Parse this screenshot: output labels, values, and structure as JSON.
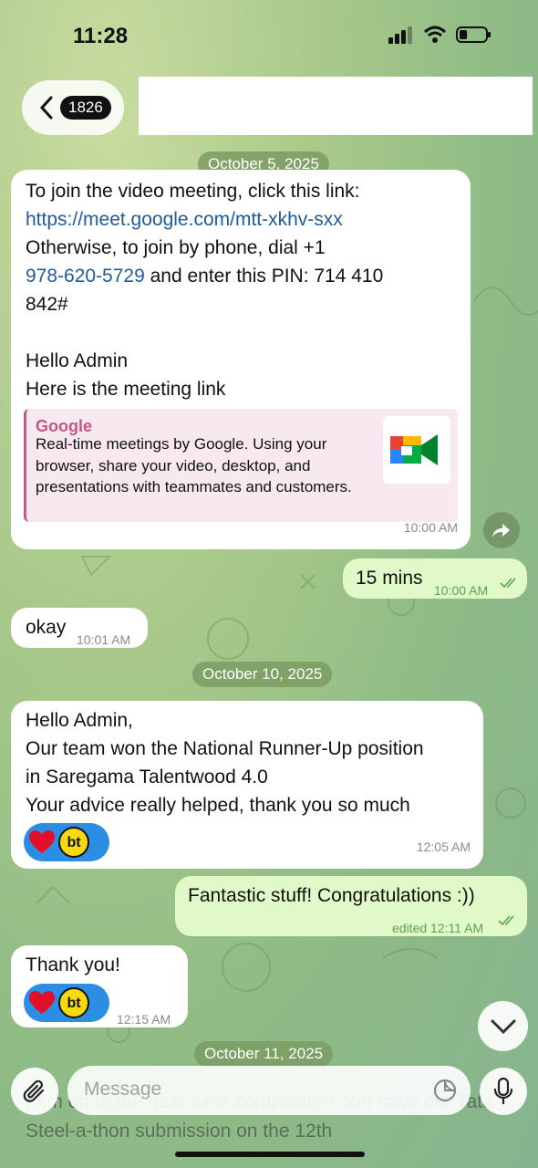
{
  "status_bar": {
    "time": "11:28",
    "battery_level": 0.3
  },
  "header": {
    "back_count": "1826"
  },
  "dates": {
    "oct5": "October 5, 2025",
    "oct10": "October 10, 2025",
    "oct11": "October 11, 2025"
  },
  "messages": {
    "m1": {
      "line1": "To join the video meeting, click this link:",
      "link": "https://meet.google.com/mtt-xkhv-sxx",
      "line3": "Otherwise, to join by phone, dial +1",
      "phone": "978-620-5729",
      "line4b": " and enter this PIN: 714 410",
      "line5": "842#",
      "line6": "Hello Admin",
      "line7": "Here is the meeting link",
      "preview_title": "Google",
      "preview_text": "Real-time meetings by Google. Using your browser, share your video, desktop, and presentations with teammates and customers.",
      "time": "10:00 AM"
    },
    "m2": {
      "text": "15 mins",
      "time": "10:00 AM"
    },
    "m3": {
      "text": "okay",
      "time": "10:01 AM"
    },
    "m4": {
      "line1": "Hello Admin,",
      "line2": "Our team won the National Runner-Up position",
      "line3": "in Saregama Talentwood 4.0",
      "line4": "Your advice really helped, thank you so much",
      "reaction_badge": "bt",
      "time": "12:05 AM"
    },
    "m5": {
      "text": "Fantastic stuff! Congratulations :))",
      "time": "edited 12:11 AM"
    },
    "m6": {
      "text": "Thank you!",
      "reaction_badge": "bt",
      "time": "12:15 AM"
    },
    "m7": {
      "text": "I am on to the next case competition. We have our Tata Steel-a-thon submission on the 12th"
    }
  },
  "composer": {
    "placeholder": "Message"
  },
  "colors": {
    "outgoing_bubble": "#e1f8c8",
    "link": "#1f5b9a",
    "preview_accent": "#c2578a",
    "reaction_bg": "#2b8de3"
  },
  "icons": [
    "back-chevron-icon",
    "share-arrow-icon",
    "double-check-icon",
    "heart-icon",
    "chevron-down-icon",
    "paperclip-icon",
    "sticker-icon",
    "microphone-icon",
    "google-meet-icon"
  ]
}
